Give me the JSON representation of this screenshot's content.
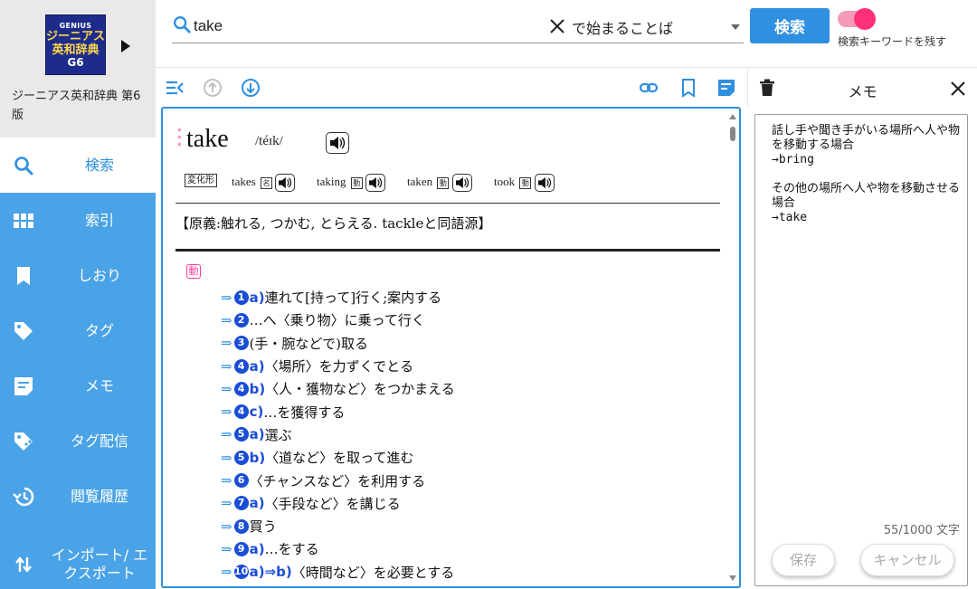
{
  "sidebar": {
    "logo": {
      "line1": "GENIUS",
      "line2": "ジーニアス",
      "line3": "英和辞典",
      "line4": "G6"
    },
    "dict_name": "ジーニアス英和辞典 第6版",
    "items": [
      {
        "label": "検索",
        "icon": "search-icon"
      },
      {
        "label": "索引",
        "icon": "grid-icon"
      },
      {
        "label": "しおり",
        "icon": "bookmark-icon"
      },
      {
        "label": "タグ",
        "icon": "tag-icon"
      },
      {
        "label": "メモ",
        "icon": "memo-icon"
      },
      {
        "label": "タグ配信",
        "icon": "tag-share-icon"
      },
      {
        "label": "閲覧履歴",
        "icon": "history-icon"
      },
      {
        "label": "インポート/ エクスポート",
        "icon": "import-export-icon"
      }
    ]
  },
  "search": {
    "query": "take",
    "mode": "で始まることば",
    "button": "検索",
    "keep_label": "検索キーワードを残す",
    "keep_enabled": true
  },
  "entry": {
    "headword": "take",
    "pronunciation": "/téɪk/",
    "forms_badge": "変化形",
    "forms": [
      {
        "word": "takes",
        "badge": "名"
      },
      {
        "word": "taking",
        "badge": "動"
      },
      {
        "word": "taken",
        "badge": "動"
      },
      {
        "word": "took",
        "badge": "動"
      }
    ],
    "etymology": "【原義:触れる, つかむ, とらえる. tackleと同語源】",
    "pos": "動",
    "senses": [
      {
        "num": "1",
        "sub": "a)",
        "text": "連れて[持って]行く;案内する"
      },
      {
        "num": "2",
        "sub": "",
        "text": "…へ〈乗り物〉に乗って行く"
      },
      {
        "num": "3",
        "sub": "",
        "text": "(手・腕などで)取る"
      },
      {
        "num": "4",
        "sub": "a)",
        "text": "〈場所〉を力ずくでとる"
      },
      {
        "num": "4",
        "sub": "b)",
        "text": "〈人・獲物など〉をつかまえる"
      },
      {
        "num": "4",
        "sub": "c)",
        "text": "…を獲得する"
      },
      {
        "num": "5",
        "sub": "a)",
        "text": "選ぶ"
      },
      {
        "num": "5",
        "sub": "b)",
        "text": "〈道など〉を取って進む"
      },
      {
        "num": "6",
        "sub": "",
        "text": "〈チャンスなど〉を利用する"
      },
      {
        "num": "7",
        "sub": "a)",
        "text": "〈手段など〉を講じる"
      },
      {
        "num": "8",
        "sub": "",
        "text": "買う"
      },
      {
        "num": "9",
        "sub": "a)",
        "text": "…をする"
      },
      {
        "num": "10",
        "sub": "a)⇒b)",
        "text": "〈時間など〉を必要とする"
      }
    ]
  },
  "memo": {
    "title": "メモ",
    "text": "話し手や聞き手がいる場所へ人や物を移動する場合\n→bring\n\nその他の場所へ人や物を移動させる場合\n→take",
    "count": "55/1000 文字",
    "save": "保存",
    "cancel": "キャンセル"
  },
  "colors": {
    "accent": "#2f8fe0",
    "sidebar": "#4aa3e6",
    "toggle": "#ff2f7a",
    "sense_number": "#1a4dd6"
  }
}
